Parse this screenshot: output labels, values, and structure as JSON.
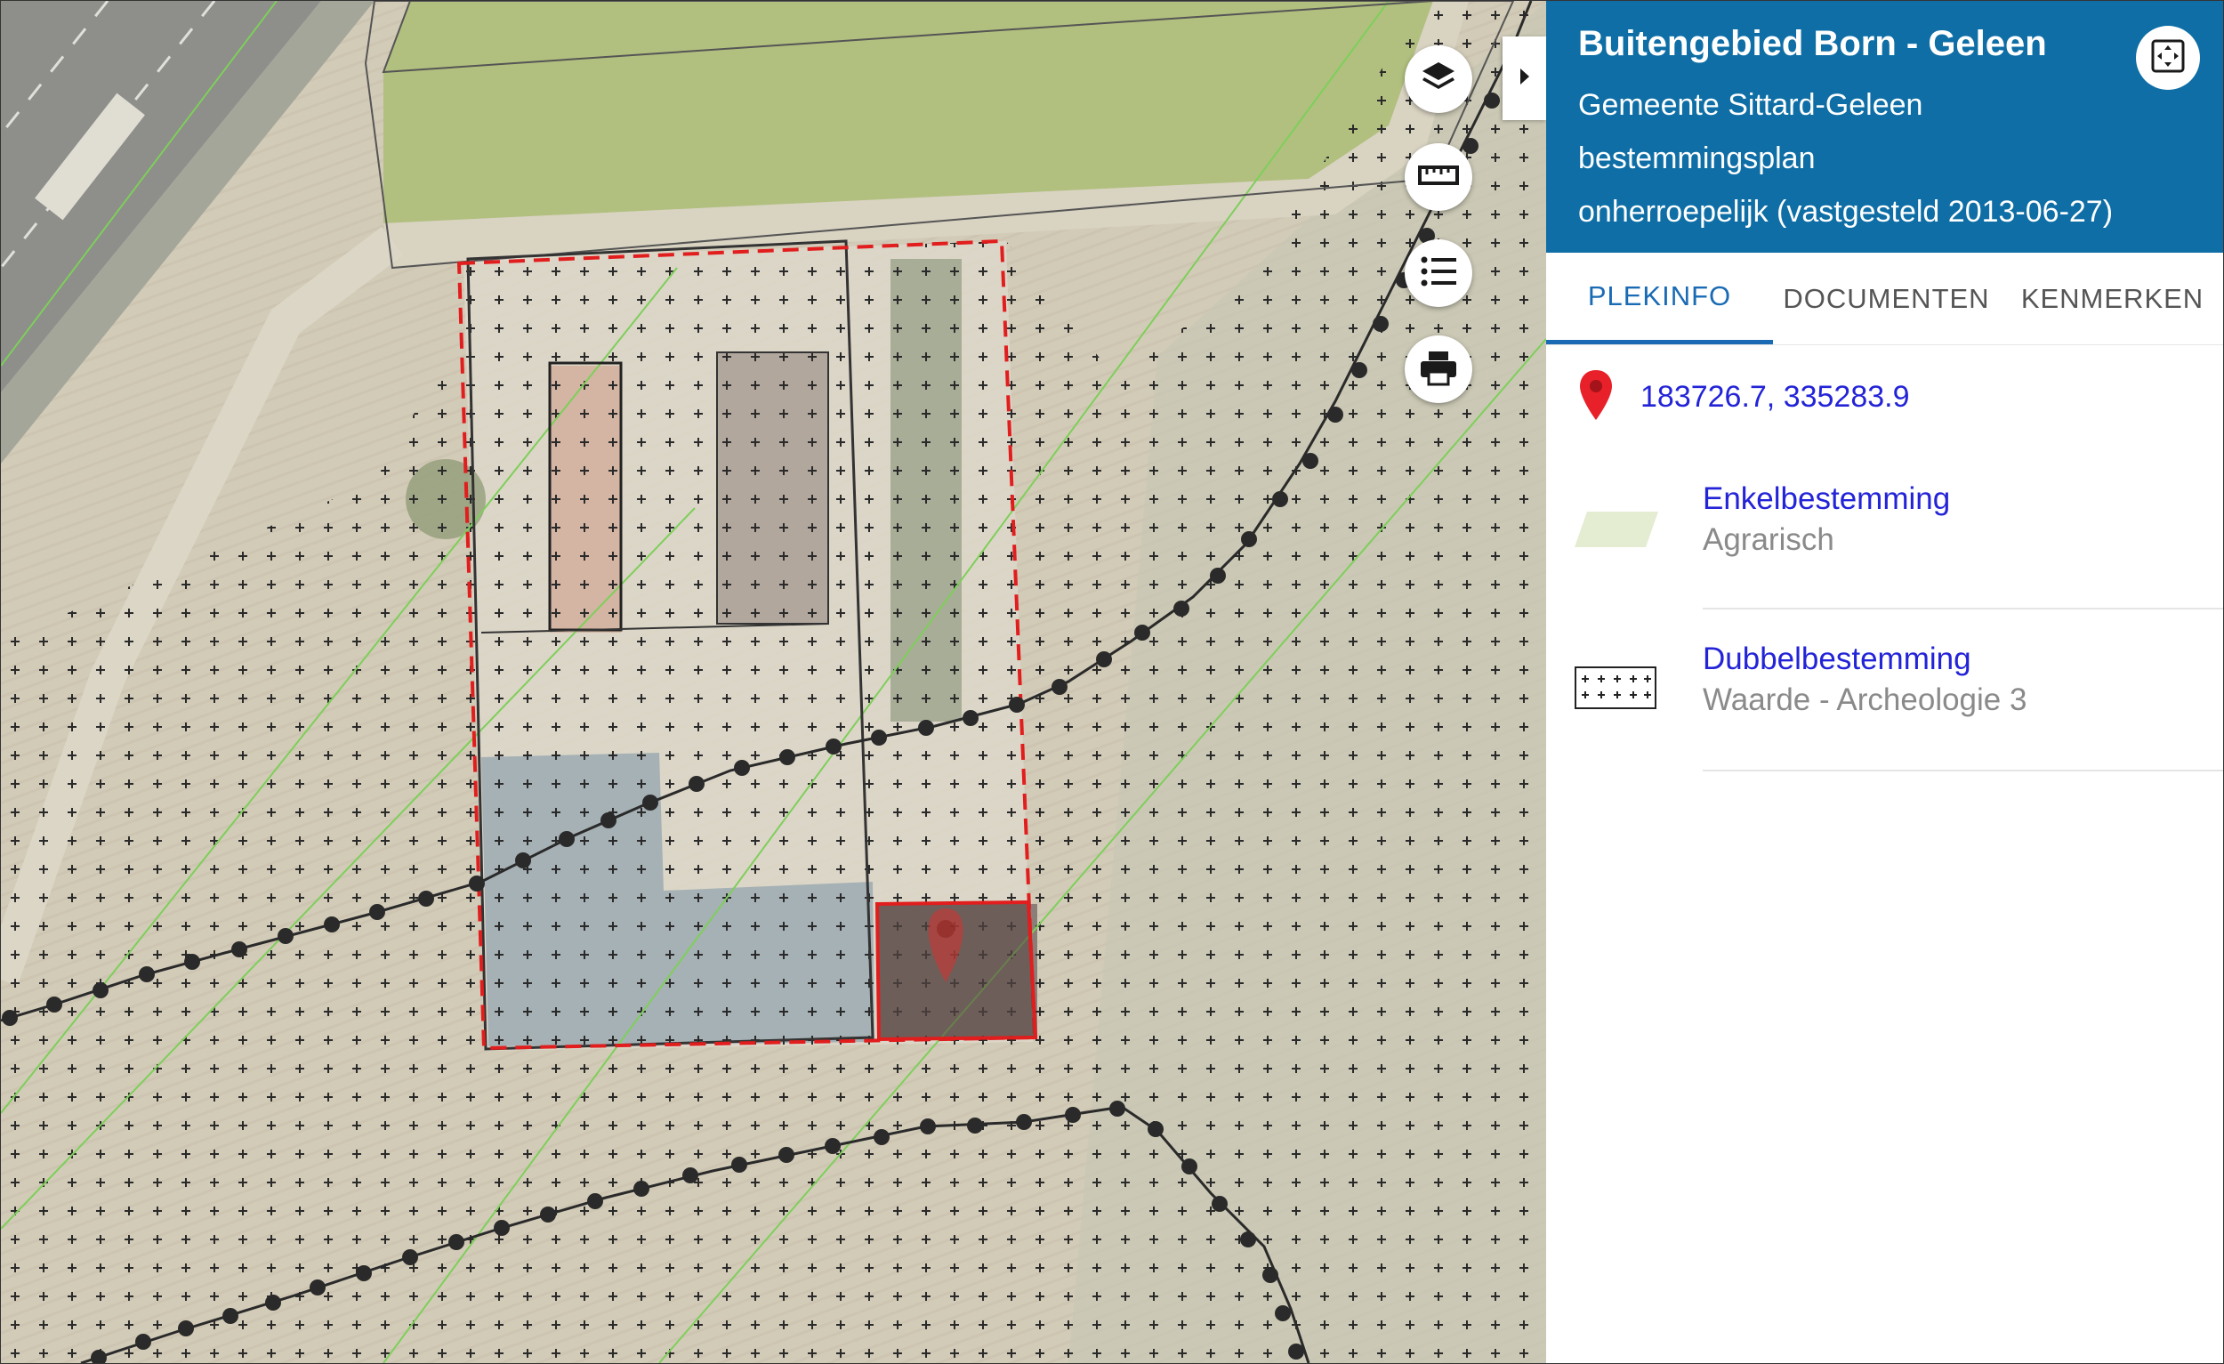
{
  "panel": {
    "title": "Buitengebied Born - Geleen",
    "municipality": "Gemeente Sittard-Geleen",
    "plan_type": "bestemmingsplan",
    "status": "onherroepelijk (vastgesteld 2013-06-27)",
    "expand_icon": "fullscreen-icon",
    "header_color": "#0e6ea5"
  },
  "tabs": [
    {
      "label": "PLEKINFO",
      "active": true
    },
    {
      "label": "DOCUMENTEN",
      "active": false
    },
    {
      "label": "KENMERKEN",
      "active": false
    }
  ],
  "location": {
    "coordinates": "183726.7, 335283.9",
    "icon": "map-pin-icon",
    "pin_color": "#e8202a"
  },
  "legend": [
    {
      "name": "Enkelbestemming",
      "value": "Agrarisch",
      "swatch": "agrarisch-swatch",
      "swatch_color": "#e4ecd2"
    },
    {
      "name": "Dubbelbestemming",
      "value": "Waarde - Archeologie 3",
      "swatch": "archeologie-hatch-swatch"
    }
  ],
  "map_controls": [
    "layers-icon",
    "ruler-icon",
    "list-icon",
    "printer-icon"
  ],
  "panel_toggle_icon": "caret-right-icon",
  "colors": {
    "link": "#2323d8",
    "plan_boundary": "#e11d1d",
    "selected_parcel": "#e11d1d",
    "boundary_line": "#2a2a2a",
    "grid_line": "#7ecf5a"
  }
}
